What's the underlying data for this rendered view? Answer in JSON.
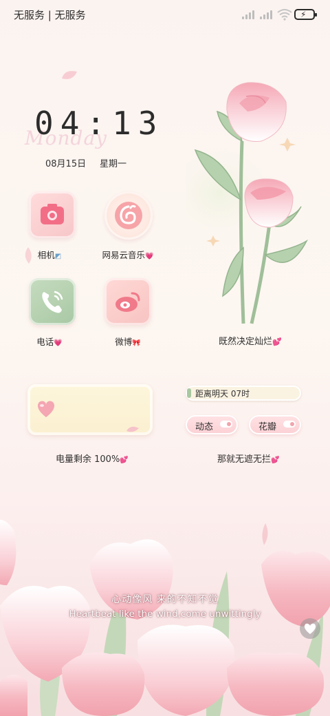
{
  "status_bar": {
    "carrier": "无服务 | 无服务",
    "icons": [
      "signal-icon",
      "signal-icon",
      "wifi-icon",
      "battery-charging-icon"
    ]
  },
  "clock": {
    "time": "04:13",
    "weekday_script": "Monday",
    "date": "08月15日",
    "weekday": "星期一"
  },
  "apps": [
    {
      "label": "相机",
      "icon": "camera-icon"
    },
    {
      "label": "网易云音乐",
      "icon": "netease-music-icon"
    },
    {
      "label": "电话",
      "icon": "phone-icon"
    },
    {
      "label": "微博",
      "icon": "weibo-icon"
    }
  ],
  "rose_widget": {
    "caption": "既然决定灿烂"
  },
  "battery_widget": {
    "label": "电量剩余 100%",
    "level_percent": 100
  },
  "countdown_widget": {
    "text": "距离明天 07时"
  },
  "toggles": [
    {
      "label": "动态"
    },
    {
      "label": "花瓣"
    }
  ],
  "motto": {
    "label": "那就无遮无拦"
  },
  "lyrics": {
    "chinese": "心动像风  来的不知不觉",
    "english": "Heartbeat like the wind,come unwittingly"
  },
  "colors": {
    "accent_pink": "#f3a7b0",
    "leaf_green": "#a8c8a4",
    "background": "#fbf3f0"
  }
}
